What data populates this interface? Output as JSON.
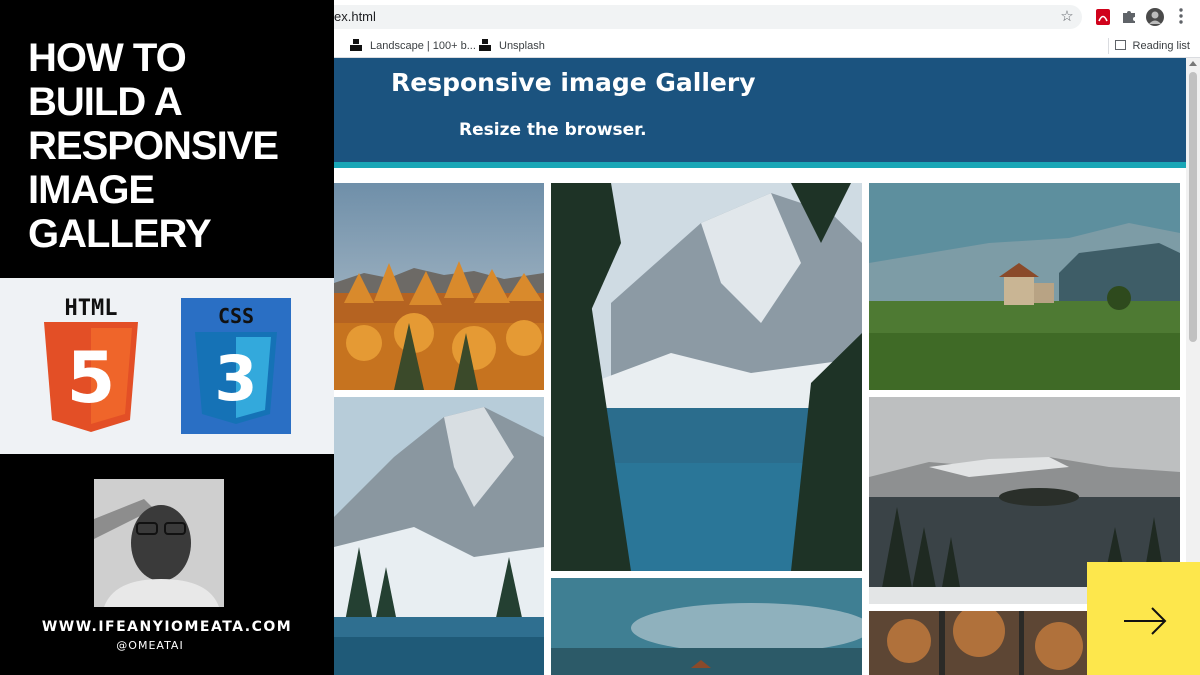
{
  "promo": {
    "title_lines": [
      "HOW TO",
      "BUILD A",
      "RESPONSIVE",
      "IMAGE",
      "GALLERY"
    ],
    "html_logo_label": "HTML",
    "html_logo_number": "5",
    "css_logo_label": "CSS",
    "css_logo_number": "3",
    "website": "WWW.IFEANYIOMEATA.COM",
    "handle": "@OMEATAI"
  },
  "browser": {
    "address_text": "ex.html",
    "bookmarks": [
      {
        "label": "Landscape | 100+ b..."
      },
      {
        "label": "Unsplash"
      }
    ],
    "reading_list_label": "Reading list"
  },
  "page": {
    "title": "Responsive image Gallery",
    "subtitle": "Resize the browser."
  },
  "colors": {
    "header_bg": "#1b537f",
    "header_stripe": "#19a6b6",
    "next_button_bg": "#fde74c"
  },
  "icons": {
    "star": "star-icon",
    "pdf": "pdf-icon",
    "extensions": "puzzle-icon",
    "menu": "more-vertical-icon",
    "next": "arrow-right-icon"
  }
}
